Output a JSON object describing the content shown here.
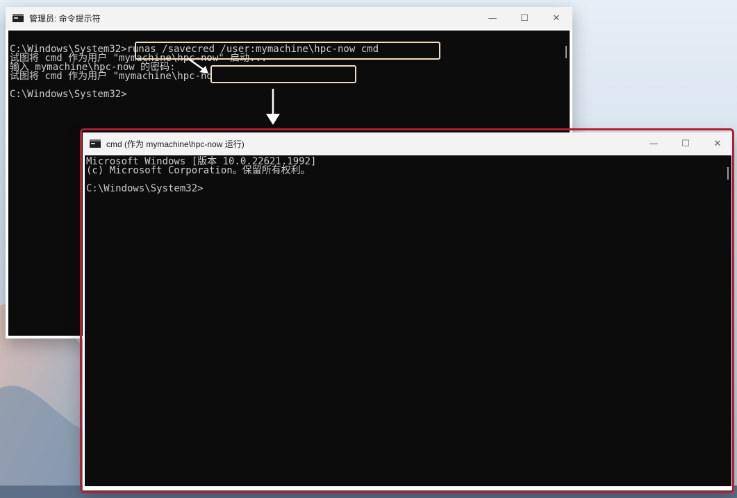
{
  "admin_window": {
    "title": "管理员: 命令提示符",
    "controls": {
      "minimize": "—",
      "maximize": "☐",
      "close": "✕"
    },
    "lines": [
      "C:\\Windows\\System32>runas /savecred /user:mymachine\\hpc-now cmd",
      "试图将 cmd 作为用户 \"mymachine\\hpc-now\" 启动...",
      "输入 mymachine\\hpc-now 的密码:",
      "试图将 cmd 作为用户 \"mymachine\\hpc-now\" 启动...",
      "",
      "C:\\Windows\\System32>"
    ]
  },
  "user_window": {
    "title": "cmd (作为 mymachine\\hpc-now 运行)",
    "controls": {
      "minimize": "—",
      "maximize": "☐",
      "close": "✕"
    },
    "lines": [
      "Microsoft Windows [版本 10.0.22621.1992]",
      "(c) Microsoft Corporation。保留所有权利。",
      "",
      "C:\\Windows\\System32>"
    ]
  },
  "annotations": {
    "highlight_color": "#f4dcc2",
    "outline_color": "#b0202e"
  }
}
